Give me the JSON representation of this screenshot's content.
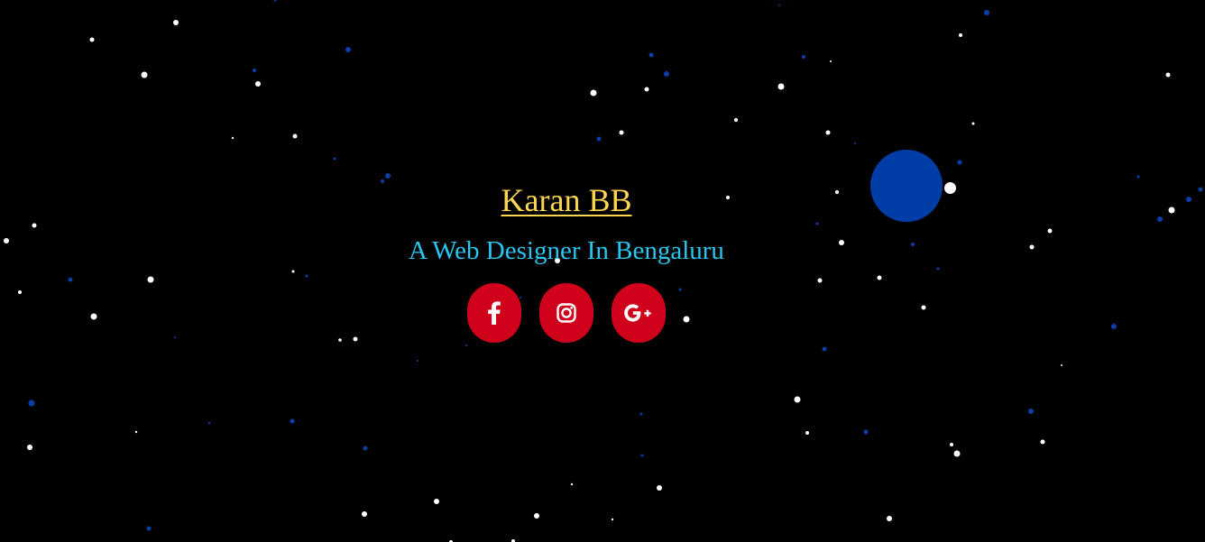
{
  "hero": {
    "name": "Karan BB",
    "tagline": "A Web Designer In Bengaluru"
  },
  "socials": [
    {
      "label": "facebook",
      "icon": "facebook-icon"
    },
    {
      "label": "instagram",
      "icon": "instagram-icon"
    },
    {
      "label": "google-plus",
      "icon": "google-plus-icon"
    }
  ],
  "colors": {
    "background": "#000000",
    "name": "#ffd54f",
    "tagline": "#29c7f0",
    "social_button": "#d0021b",
    "social_icon": "#ffffff",
    "planet": "#003da6",
    "star_white": "#ffffff",
    "star_blue": "#0a3fa8"
  }
}
